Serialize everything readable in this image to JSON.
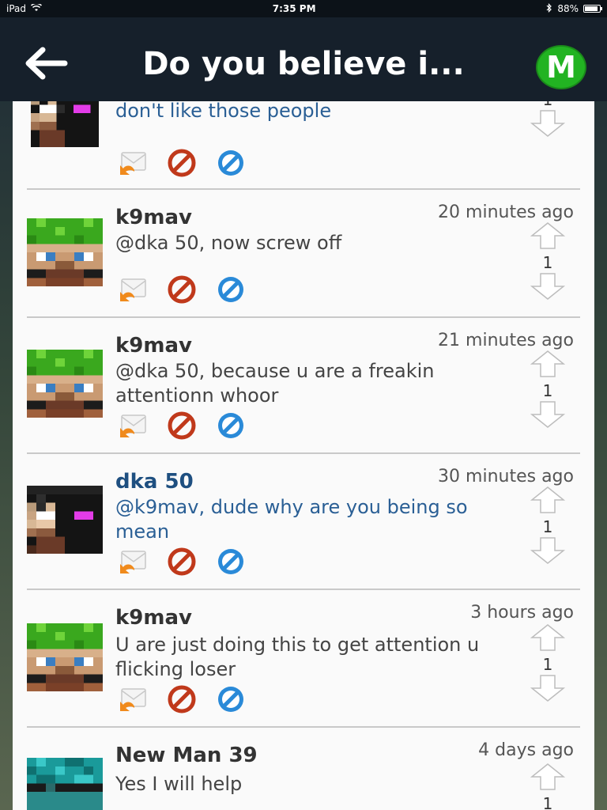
{
  "status_bar": {
    "device": "iPad",
    "time": "7:35 PM",
    "battery": "88%",
    "battery_level": 0.88
  },
  "nav": {
    "title": "Do you believe i...",
    "badge": "M"
  },
  "comments": [
    {
      "username": "",
      "time": "",
      "text": "@Lane Family is awesome, yeah I don't like those people",
      "votes": "1",
      "avatar": "enderman"
    },
    {
      "username": "k9mav",
      "time": "20 minutes ago",
      "text": "@dka 50, now screw off",
      "votes": "1",
      "avatar": "green-steve"
    },
    {
      "username": "k9mav",
      "time": "21 minutes ago",
      "text": "@dka 50, because u are a freakin attentionn whoor",
      "votes": "1",
      "avatar": "green-steve"
    },
    {
      "username": "dka 50",
      "time": "30 minutes ago",
      "text": "@k9mav, dude why are you being so mean",
      "votes": "1",
      "avatar": "enderman"
    },
    {
      "username": "k9mav",
      "time": "3 hours ago",
      "text": "U are just doing this to get attention u flicking loser",
      "votes": "1",
      "avatar": "green-steve"
    },
    {
      "username": "New Man 39",
      "time": "4 days ago",
      "text": "Yes I will help",
      "votes": "1",
      "avatar": "teal-creeper"
    }
  ],
  "colors": {
    "nav_bg": "#16202b",
    "badge_green": "#22b322",
    "link_blue": "#2a5f95",
    "block_red": "#c0391b",
    "ban_blue": "#2a8ad8",
    "reply_orange": "#f08a1c"
  },
  "icons": {
    "back": "arrow-left-icon",
    "reply": "reply-envelope-icon",
    "block": "prohibited-icon",
    "ban": "blue-slash-icon",
    "upvote": "arrow-up-icon",
    "downvote": "arrow-down-icon"
  }
}
